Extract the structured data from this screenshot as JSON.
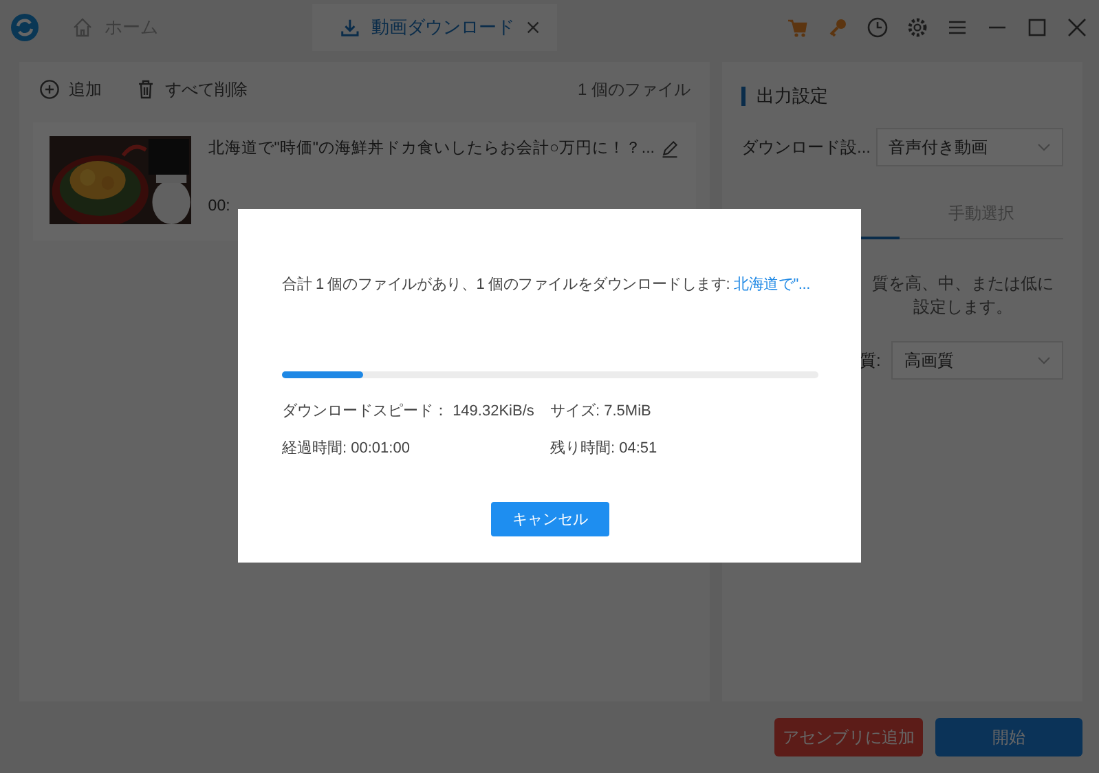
{
  "title_bar": {
    "tabs": [
      {
        "label": "ホーム",
        "kind": "home",
        "selected": false
      },
      {
        "label": "動画ダウンロード",
        "kind": "download",
        "selected": true
      }
    ]
  },
  "toolbar": {
    "add": "追加",
    "delete_all": "すべて削除",
    "file_count": "1 個のファイル"
  },
  "files": [
    {
      "title": "北海道で\"時価\"の海鮮丼ドカ食いしたらお会計○万円に！？...",
      "time": "00:"
    }
  ],
  "output_settings": {
    "heading": "出力設定",
    "download_label": "ダウンロード設...",
    "download_value": "音声付き動画",
    "tabs": [
      {
        "label": "手動選択",
        "selected": false
      }
    ],
    "description": "質を高、中、または低に設定します。",
    "quality_label": "質:",
    "quality_value": "高画質"
  },
  "bottom_buttons": [
    {
      "label": "アセンブリに追加",
      "kind": "secondary"
    },
    {
      "label": "開始",
      "kind": "primary"
    }
  ],
  "dialog": {
    "message_prefix": "合計 1 個のファイルがあり、1 個のファイルをダウンロードします: ",
    "message_link": "北海道で\"...",
    "progress": {
      "level": 0.15
    },
    "speed_label": "ダウンロードスピード：",
    "speed_value": "149.32KiB/s",
    "size": "サイズ: 7.5MiB",
    "elapsed": "経過時間: 00:01:00",
    "remaining": "残り時間: 04:51",
    "cancel": "キャンセル"
  }
}
